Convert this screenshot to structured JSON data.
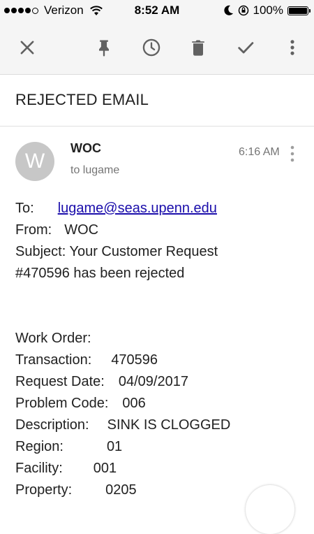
{
  "status_bar": {
    "carrier": "Verizon",
    "time": "8:52 AM",
    "battery": "100%",
    "signal_bars_filled": 4,
    "signal_bars_total": 5
  },
  "toolbar": {
    "icons": [
      "close-icon",
      "pin-icon",
      "snooze-clock-icon",
      "delete-icon",
      "done-check-icon",
      "more-vert-icon"
    ]
  },
  "email": {
    "subject_title": "REJECTED EMAIL",
    "avatar_letter": "W",
    "sender": "WOC",
    "recipient_line": "to lugame",
    "time": "6:16 AM",
    "body": {
      "to_label": "To:",
      "to_email": "lugame@seas.upenn.edu",
      "from_label": "From:",
      "from_value": "WOC",
      "subject_label": "Subject:",
      "subject_line1": "Your Customer Request",
      "subject_line2": "#470596 has been rejected",
      "work_order_label": "Work Order:",
      "transaction_label": "Transaction:",
      "transaction_value": "470596",
      "request_date_label": "Request Date:",
      "request_date_value": "04/09/2017",
      "problem_code_label": "Problem Code:",
      "problem_code_value": "006",
      "description_label": "Description:",
      "description_value": "SINK IS CLOGGED",
      "region_label": "Region:",
      "region_value": "01",
      "facility_label": "Facility:",
      "facility_value": "001",
      "property_label": "Property:",
      "property_value": "0205"
    }
  },
  "colors": {
    "toolbar_bg": "#f5f5f5",
    "icon_gray": "#616161",
    "avatar_bg": "#c7c7c7",
    "link_blue": "#1a0dab",
    "secondary_text": "#757575"
  }
}
